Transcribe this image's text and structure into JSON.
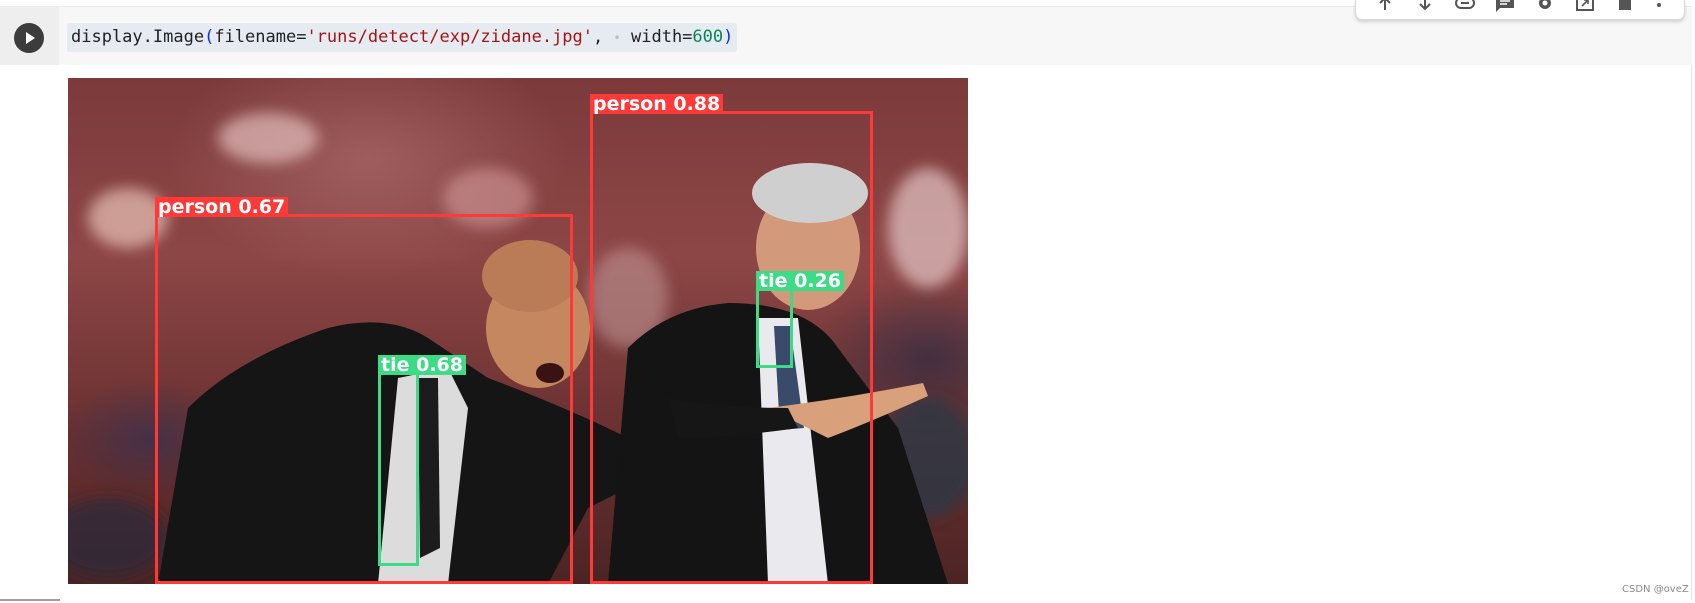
{
  "code": {
    "fn": "display.Image",
    "arg1_name": "filename=",
    "arg1_value": "'runs/detect/exp/zidane.jpg'",
    "comma": ",",
    "arg2_name": "width=",
    "arg2_value": "600"
  },
  "colors": {
    "person_box": "#ff3838",
    "tie_box": "#3ddb86"
  },
  "toolbar": {
    "icons": [
      "move-up-icon",
      "move-down-icon",
      "link-icon",
      "comment-icon",
      "settings-icon",
      "open-in-tab-icon",
      "delete-icon",
      "more-icon"
    ]
  },
  "detections": [
    {
      "label": "person 0.67",
      "class": "person"
    },
    {
      "label": "tie 0.68",
      "class": "tie"
    },
    {
      "label": "person 0.88",
      "class": "person"
    },
    {
      "label": "tie 0.26",
      "class": "tie"
    }
  ],
  "watermark": "CSDN @oveZ"
}
